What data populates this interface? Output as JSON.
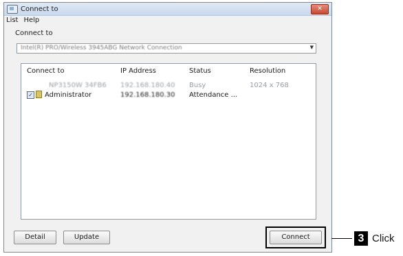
{
  "window": {
    "title": "Connect to"
  },
  "menu": {
    "items": [
      "List",
      "Help"
    ]
  },
  "connect_to": {
    "label": "Connect to",
    "selected": "Intel(R) PRO/Wireless 3945ABG Network Connection"
  },
  "table": {
    "headers": [
      "Connect to",
      "IP Address",
      "Status",
      "Resolution"
    ],
    "rows": [
      {
        "name": "NP3150W 34FB6",
        "ip": "192.168.180.40",
        "status": "Busy",
        "resolution": "1024 x 768",
        "checked": false
      },
      {
        "name": "Administrator",
        "ip": "192.168.180.30",
        "status": "Attendance ...",
        "resolution": "",
        "checked": true
      }
    ]
  },
  "buttons": {
    "detail": "Detail",
    "update": "Update",
    "connect": "Connect"
  },
  "callout": {
    "number": "3",
    "text": "Click"
  },
  "colors": {
    "highlight_border": "#000000",
    "badge_bg": "#000000",
    "close_button": "#c44a33"
  },
  "icons": {
    "app": "connect-app-icon",
    "close": "close-icon",
    "dropdown": "chevron-down-icon",
    "user": "user-icon",
    "check": "checkbox-checked-icon"
  }
}
